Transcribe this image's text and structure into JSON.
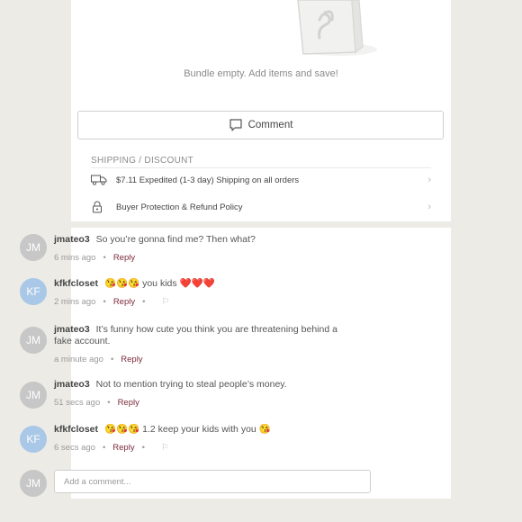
{
  "bundle": {
    "empty_text": "Bundle empty. Add items and save!"
  },
  "comment_button": {
    "label": "Comment"
  },
  "shipping": {
    "heading": "SHIPPING / DISCOUNT",
    "rows": [
      {
        "icon": "truck-icon",
        "text": "$7.11 Expedited (1-3 day) Shipping on all orders"
      },
      {
        "icon": "lock-icon",
        "text": "Buyer Protection & Refund Policy"
      }
    ]
  },
  "comments": [
    {
      "avatar": "JM",
      "user": "jmateo3",
      "text": "So you’re gonna find me? Then what?",
      "time": "6 mins ago",
      "reply": "Reply",
      "flag": false
    },
    {
      "avatar": "KF",
      "user": "kfkfcloset",
      "text": "😘😘😘 you kids ❤️❤️❤️",
      "time": "2 mins ago",
      "reply": "Reply",
      "flag": true
    },
    {
      "avatar": "JM",
      "user": "jmateo3",
      "text": "It’s funny how cute you think you are threatening behind a fake account.",
      "time": "a minute ago",
      "reply": "Reply",
      "flag": false
    },
    {
      "avatar": "JM",
      "user": "jmateo3",
      "text": "Not to mention trying to steal people’s money.",
      "time": "51 secs ago",
      "reply": "Reply",
      "flag": false
    },
    {
      "avatar": "KF",
      "user": "kfkfcloset",
      "text": "😘😘😘 1.2 keep your kids with you 😘",
      "time": "6 secs ago",
      "reply": "Reply",
      "flag": true
    }
  ],
  "add_comment": {
    "avatar": "JM",
    "placeholder": "Add a comment..."
  },
  "colors": {
    "reply": "#7b2c3e",
    "avatar_gray": "#c7c7c7",
    "avatar_blue": "#a9c7e6"
  }
}
